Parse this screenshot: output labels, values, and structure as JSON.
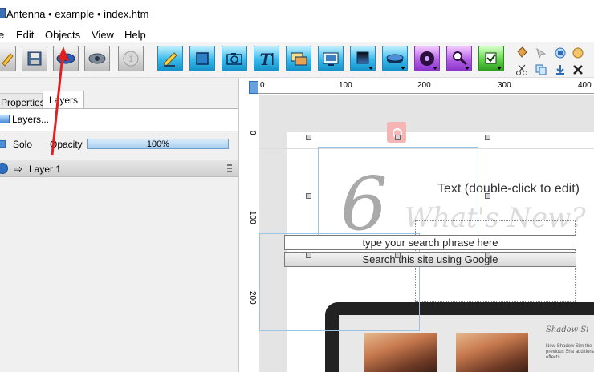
{
  "window": {
    "title": "Antenna • example • index.htm"
  },
  "menu": {
    "items": [
      "e",
      "Edit",
      "Objects",
      "View",
      "Help"
    ]
  },
  "toolbar": {
    "buttons": [
      "open-icon",
      "save-icon",
      "eye-preview-icon",
      "eye-icon",
      "info-icon",
      "edit-pencil-icon",
      "rectangle-icon",
      "camera-icon",
      "text-icon",
      "image-icon",
      "video-icon",
      "gradient-icon",
      "disc-icon",
      "music-icon",
      "search-icon",
      "checkbox-icon"
    ],
    "mini_tools": [
      "bucket-icon",
      "cut-icon",
      "copy-icon",
      "paste-icon",
      "delete-icon",
      "undo-icon",
      "redo-icon",
      "erase-icon"
    ]
  },
  "left_panel": {
    "tabs": [
      "Properties",
      "Layers"
    ],
    "active_tab": "Layers",
    "layers_button": "Layers...",
    "solo_label": "Solo",
    "opacity_label": "Opacity",
    "opacity_value": "100%",
    "layers": [
      {
        "name": "Layer 1"
      }
    ]
  },
  "rulers": {
    "horizontal": [
      "0",
      "100",
      "200",
      "300",
      "400"
    ],
    "vertical": [
      "0",
      "100",
      "200"
    ]
  },
  "canvas": {
    "number_graphic": "6",
    "heading_graphic": "What's New?",
    "text_placeholder": "Text (double-click to edit)",
    "search_placeholder": "type your search phrase here",
    "search_button": "Search this site using Google",
    "laptop_heading": "Shadow Si",
    "laptop_body": "New Shadow Sim the previous Sha additional effects."
  },
  "colors": {
    "toolbar_cyan": "#36b9ea",
    "selection": "#9bc3e6",
    "annotation_arrow": "#e02020"
  }
}
